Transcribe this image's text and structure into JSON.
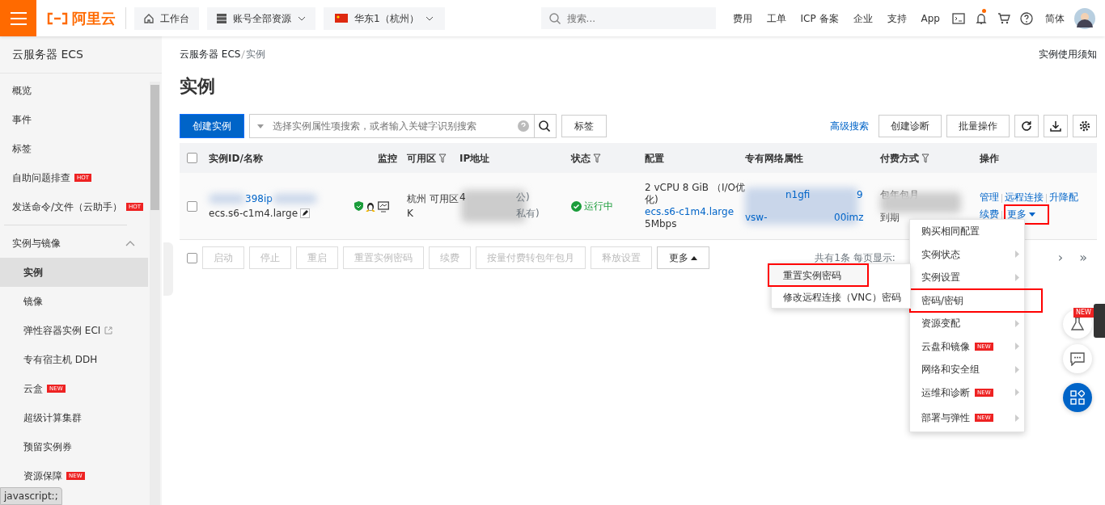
{
  "topbar": {
    "logo": "阿里云",
    "workbench": "工作台",
    "resources": "账号全部资源",
    "region": "华东1（杭州）",
    "search_placeholder": "搜索...",
    "links": [
      "费用",
      "工单",
      "ICP 备案",
      "企业",
      "支持",
      "App"
    ],
    "language": "简体",
    "notification_dot": true
  },
  "sidebar": {
    "title": "云服务器 ECS",
    "items": [
      {
        "label": "概览"
      },
      {
        "label": "事件"
      },
      {
        "label": "标签"
      },
      {
        "label": "自助问题排查",
        "badge": "HOT"
      },
      {
        "label": "发送命令/文件（云助手）",
        "badge": "HOT"
      }
    ],
    "group": {
      "label": "实例与镜像",
      "expanded": true,
      "children": [
        {
          "label": "实例",
          "selected": true
        },
        {
          "label": "镜像",
          "selected": false
        },
        {
          "label": "弹性容器实例 ECI",
          "selected": false,
          "external": true
        },
        {
          "label": "专有宿主机 DDH",
          "selected": false
        },
        {
          "label": "云盒",
          "selected": false,
          "badge": "NEW"
        },
        {
          "label": "超级计算集群",
          "selected": false
        },
        {
          "label": "预留实例券",
          "selected": false
        },
        {
          "label": "资源保障",
          "selected": false,
          "badge": "NEW"
        }
      ]
    }
  },
  "breadcrumb": [
    "云服务器 ECS",
    "实例"
  ],
  "notice_link": "实例使用须知",
  "page_title": "实例",
  "toolbar": {
    "create": "创建实例",
    "search_placeholder": "选择实例属性项搜索，或者输入关键字识别搜索",
    "tags": "标签",
    "advanced": "高级搜索",
    "diagnose": "创建诊断",
    "batch": "批量操作"
  },
  "table": {
    "all_checked": false,
    "columns": [
      {
        "label": "实例ID/名称",
        "filter": false
      },
      {
        "label": "监控",
        "filter": false
      },
      {
        "label": "可用区",
        "filter": true
      },
      {
        "label": "IP地址",
        "filter": false
      },
      {
        "label": "状态",
        "filter": true
      },
      {
        "label": "配置",
        "filter": false
      },
      {
        "label": "专有网络属性",
        "filter": false
      },
      {
        "label": "付费方式",
        "filter": true
      },
      {
        "label": "操作",
        "filter": false
      }
    ],
    "rows": [
      {
        "checked": false,
        "id": "398ip",
        "type": "ecs.s6-c1m4.large",
        "zone": "杭州 可用区K",
        "ip": [
          "4",
          "公)",
          "私有)"
        ],
        "status": "运行中",
        "config": [
          "2 vCPU 8 GiB （I/O优化)",
          "ecs.s6-c1m4.large",
          "5Mbps"
        ],
        "vpc": [
          "n1gfi",
          "9",
          "vsw-",
          "00imz"
        ],
        "pay": [
          "包年包月",
          "到期"
        ],
        "actions": [
          "管理",
          "远程连接",
          "升降配",
          "续费"
        ],
        "more": {
          "label": "更多",
          "annotated": true
        }
      }
    ]
  },
  "footer": {
    "select_all_checked": false,
    "buttons": [
      "启动",
      "停止",
      "重启",
      "重置实例密码",
      "续费",
      "按量付费转包年包月",
      "释放设置"
    ],
    "more": "更多",
    "count": "共有1条 每页显示:",
    "next": "›",
    "last": "»"
  },
  "menu": [
    {
      "label": "购买相同配置",
      "submenu": false,
      "annotated": false
    },
    {
      "label": "实例状态",
      "submenu": true,
      "annotated": false
    },
    {
      "label": "实例设置",
      "submenu": true,
      "annotated": false
    },
    {
      "label": "密码/密钥",
      "submenu": false,
      "annotated": true
    },
    {
      "label": "资源变配",
      "submenu": true,
      "annotated": false
    },
    {
      "label": "云盘和镜像",
      "submenu": true,
      "annotated": false,
      "badge": "NEW"
    },
    {
      "label": "网络和安全组",
      "submenu": true,
      "annotated": false
    },
    {
      "label": "运维和诊断",
      "submenu": true,
      "annotated": false,
      "badge": "NEW"
    },
    {
      "label": "部署与弹性",
      "submenu": true,
      "annotated": false,
      "badge": "NEW"
    }
  ],
  "submenu": [
    {
      "label": "重置实例密码",
      "selected": true,
      "annotated": true
    },
    {
      "label": "修改远程连接（VNC）密码",
      "selected": false,
      "annotated": false
    }
  ],
  "float_badge": "NEW",
  "status_bar": "javascript:;"
}
